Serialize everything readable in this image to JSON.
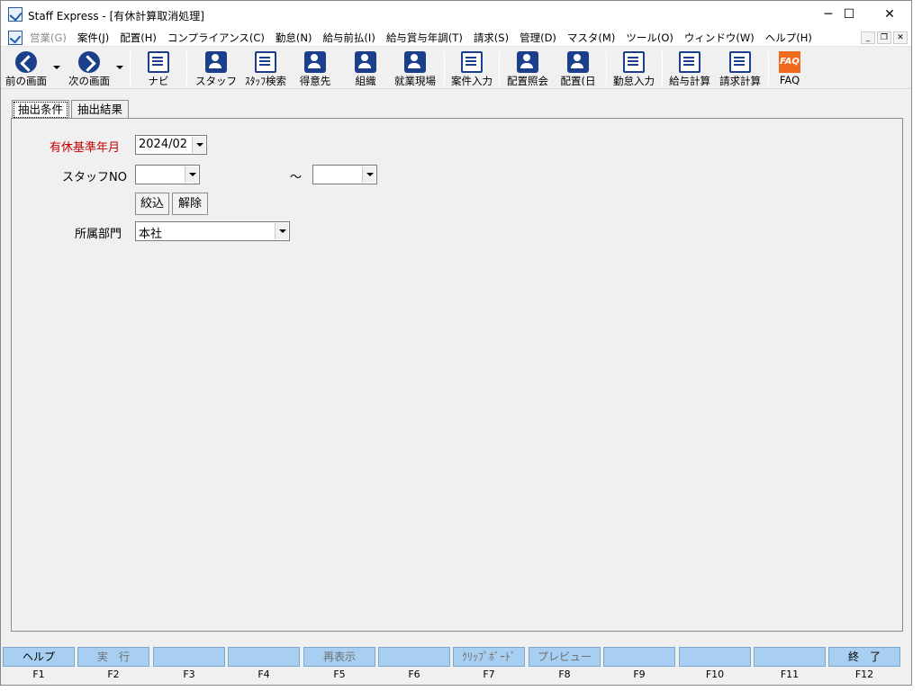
{
  "window": {
    "title": "Staff Express - [有休計算取消処理]",
    "minimize": "─",
    "maximize": "☐",
    "close": "✕"
  },
  "menu": {
    "items": [
      {
        "label": "営業(G)",
        "disabled": true
      },
      {
        "label": "案件(J)",
        "disabled": false
      },
      {
        "label": "配置(H)",
        "disabled": false
      },
      {
        "label": "コンプライアンス(C)",
        "disabled": false
      },
      {
        "label": "勤怠(N)",
        "disabled": false
      },
      {
        "label": "給与前払(I)",
        "disabled": false
      },
      {
        "label": "給与賞与年調(T)",
        "disabled": false
      },
      {
        "label": "請求(S)",
        "disabled": false
      },
      {
        "label": "管理(D)",
        "disabled": false
      },
      {
        "label": "マスタ(M)",
        "disabled": false
      },
      {
        "label": "ツール(O)",
        "disabled": false
      },
      {
        "label": "ウィンドウ(W)",
        "disabled": false
      },
      {
        "label": "ヘルプ(H)",
        "disabled": false
      }
    ],
    "mdi_minimize": "_",
    "mdi_restore": "❐",
    "mdi_close": "✕"
  },
  "toolbar": {
    "back": "前の画面",
    "forward": "次の画面",
    "navi": "ナビ",
    "staff": "スタッフ",
    "staff_search": "ｽﾀｯﾌ検索",
    "customer": "得意先",
    "organization": "組織",
    "worksite": "就業現場",
    "case_input": "案件入力",
    "assign_inquiry": "配置照会",
    "assign_day": "配置(日",
    "attendance_input": "勤怠入力",
    "salary_calc": "給与計算",
    "billing_calc": "請求計算",
    "faq": "FAQ",
    "faq_icon_text": "FAQ"
  },
  "tabs": {
    "conditions": "抽出条件",
    "results": "抽出結果"
  },
  "form": {
    "base_month_label": "有休基準年月",
    "base_month_value": "2024/02",
    "staff_no_label": "スタッフNO",
    "staff_no_from": "",
    "range_sep": "～",
    "staff_no_to": "",
    "filter_button": "絞込",
    "clear_button": "解除",
    "department_label": "所属部門",
    "department_value": "本社"
  },
  "fkeys": [
    {
      "label": "ヘルプ",
      "key": "F1",
      "disabled": false
    },
    {
      "label": "実　行",
      "key": "F2",
      "disabled": true
    },
    {
      "label": "",
      "key": "F3",
      "disabled": false
    },
    {
      "label": "",
      "key": "F4",
      "disabled": false
    },
    {
      "label": "再表示",
      "key": "F5",
      "disabled": true
    },
    {
      "label": "",
      "key": "F6",
      "disabled": false
    },
    {
      "label": "ｸﾘｯﾌﾟﾎﾞｰﾄﾞ",
      "key": "F7",
      "disabled": true
    },
    {
      "label": "プレビュー",
      "key": "F8",
      "disabled": true
    },
    {
      "label": "",
      "key": "F9",
      "disabled": false
    },
    {
      "label": "",
      "key": "F10",
      "disabled": false
    },
    {
      "label": "",
      "key": "F11",
      "disabled": false
    },
    {
      "label": "終　了",
      "key": "F12",
      "disabled": false
    }
  ],
  "colors": {
    "required_label": "#c00000",
    "fkey_background": "#a8cff2",
    "icon_blue": "#1b3f8a",
    "faq_orange": "#f06a1e"
  }
}
